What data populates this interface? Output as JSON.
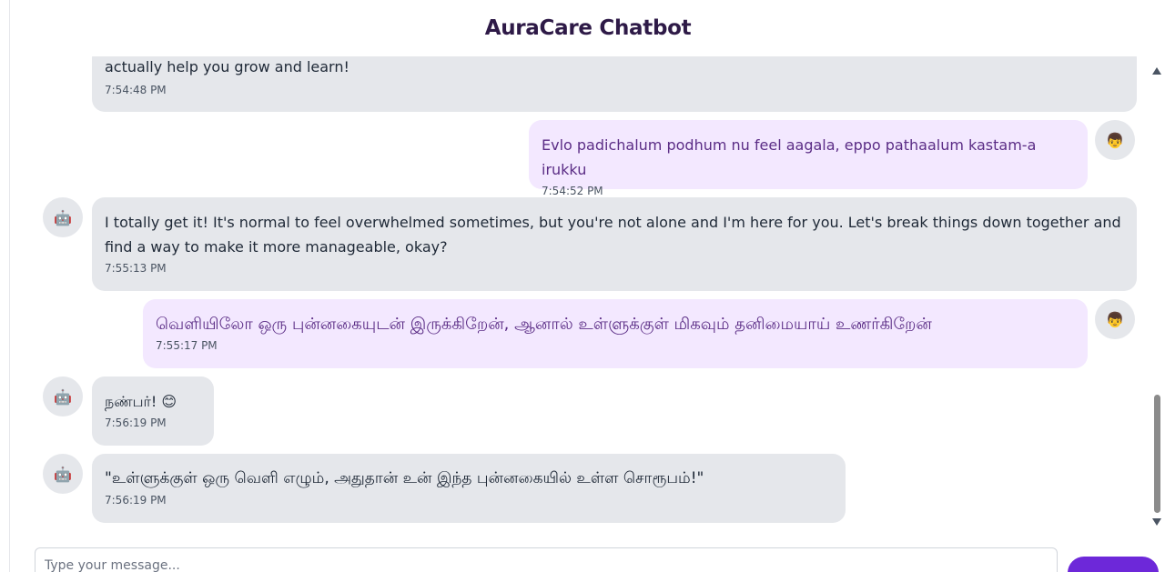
{
  "header": {
    "title": "AuraCare Chatbot"
  },
  "messages": [
    {
      "sender": "bot",
      "lines": [
        "actually help you grow and learn!"
      ],
      "time": "7:54:48 PM"
    },
    {
      "sender": "user",
      "lines": [
        "Evlo padichalum podhum nu feel aagala, eppo pathaalum kastam-a irukku"
      ],
      "time": "7:54:52 PM"
    },
    {
      "sender": "bot",
      "lines": [
        "I totally get it! It's normal to feel overwhelmed sometimes, but you're not alone and I'm here for you. Let's break things down together and",
        "find a way to make it more manageable, okay?"
      ],
      "time": "7:55:13 PM"
    },
    {
      "sender": "user",
      "lines": [
        "வெளியிலோ ஒரு புன்னகையுடன் இருக்கிறேன், ஆனால் உள்ளுக்குள் மிகவும் தனிமையாய் உணர்கிறேன்"
      ],
      "time": "7:55:17 PM"
    },
    {
      "sender": "bot",
      "lines": [
        "நண்பர்! 😊"
      ],
      "time": "7:56:19 PM"
    },
    {
      "sender": "bot",
      "lines": [
        "\"உள்ளுக்குள் ஒரு வெளி எழும், அதுதான் உன் இந்த புன்னகையில் உள்ள சொரூபம்!\""
      ],
      "time": "7:56:19 PM"
    }
  ],
  "avatars": {
    "bot": "🤖",
    "user": "👦",
    "bot_icon": "robot-icon",
    "user_icon": "user-face-icon"
  },
  "input": {
    "placeholder": "Type your message..."
  },
  "colors": {
    "bot_bubble": "#e5e7eb",
    "user_bubble": "#f3e8ff",
    "user_text": "#5b2d86",
    "title": "#2e1a47"
  }
}
